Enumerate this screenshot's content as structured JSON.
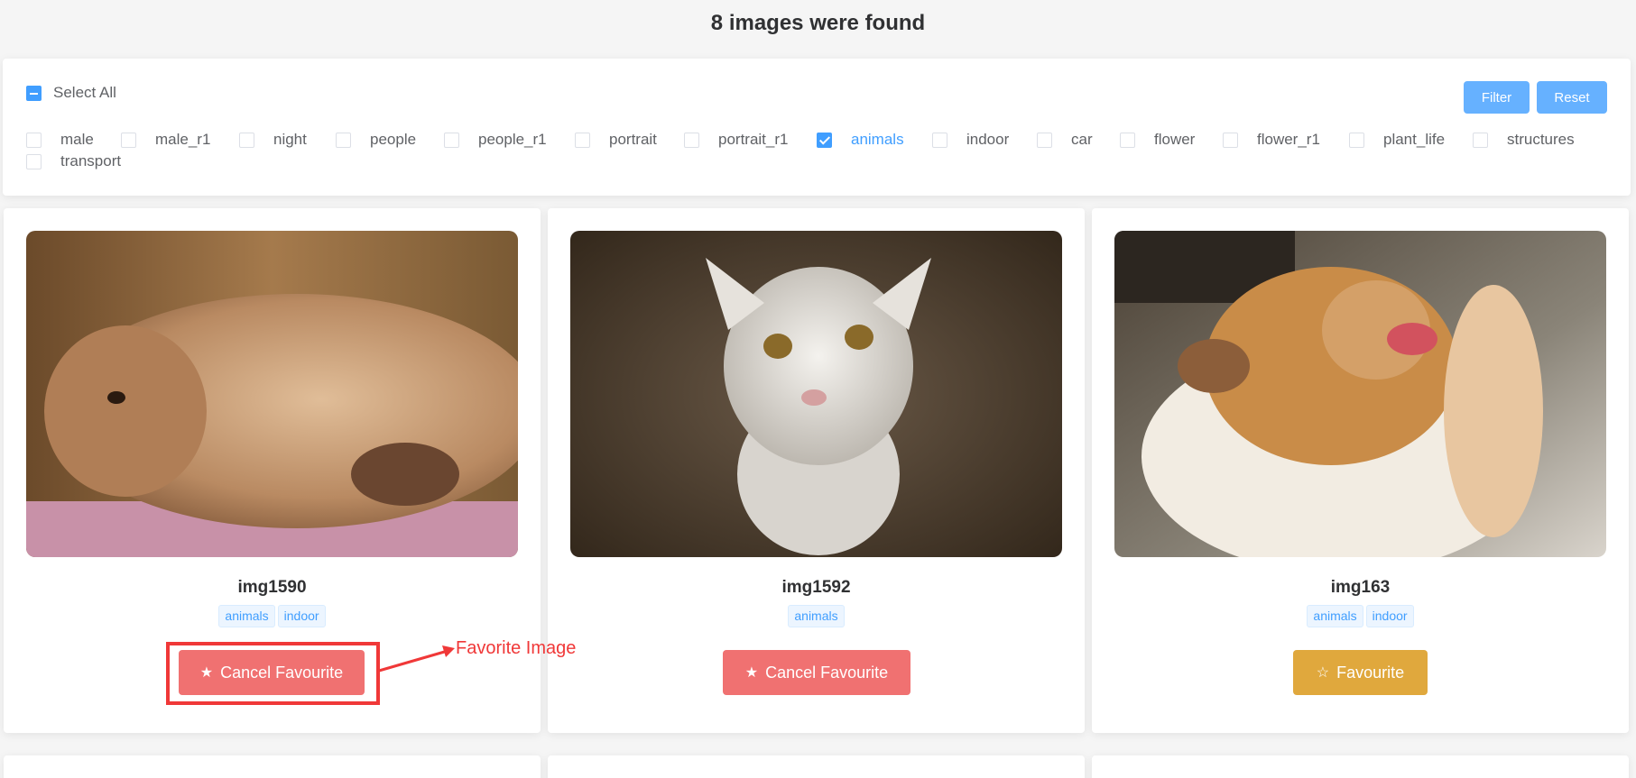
{
  "header": {
    "title": "8 images were found"
  },
  "filter": {
    "select_all_label": "Select All",
    "filter_button": "Filter",
    "reset_button": "Reset",
    "categories": [
      {
        "label": "male",
        "checked": false
      },
      {
        "label": "male_r1",
        "checked": false
      },
      {
        "label": "night",
        "checked": false
      },
      {
        "label": "people",
        "checked": false
      },
      {
        "label": "people_r1",
        "checked": false
      },
      {
        "label": "portrait",
        "checked": false
      },
      {
        "label": "portrait_r1",
        "checked": false
      },
      {
        "label": "animals",
        "checked": true
      },
      {
        "label": "indoor",
        "checked": false
      },
      {
        "label": "car",
        "checked": false
      },
      {
        "label": "flower",
        "checked": false
      },
      {
        "label": "flower_r1",
        "checked": false
      },
      {
        "label": "plant_life",
        "checked": false
      },
      {
        "label": "structures",
        "checked": false
      },
      {
        "label": "transport",
        "checked": false
      }
    ]
  },
  "cards": [
    {
      "name": "img1590",
      "tags": [
        "animals",
        "indoor"
      ],
      "button": "Cancel Favourite",
      "favourited": true
    },
    {
      "name": "img1592",
      "tags": [
        "animals"
      ],
      "button": "Cancel Favourite",
      "favourited": true
    },
    {
      "name": "img163",
      "tags": [
        "animals",
        "indoor"
      ],
      "button": "Favourite",
      "favourited": false
    }
  ],
  "annotation": {
    "text": "Favorite Image"
  },
  "colors": {
    "accent": "#409eff",
    "cancel_favourite": "#f07171",
    "favourite": "#e0a83d",
    "annotation": "#f03838"
  }
}
